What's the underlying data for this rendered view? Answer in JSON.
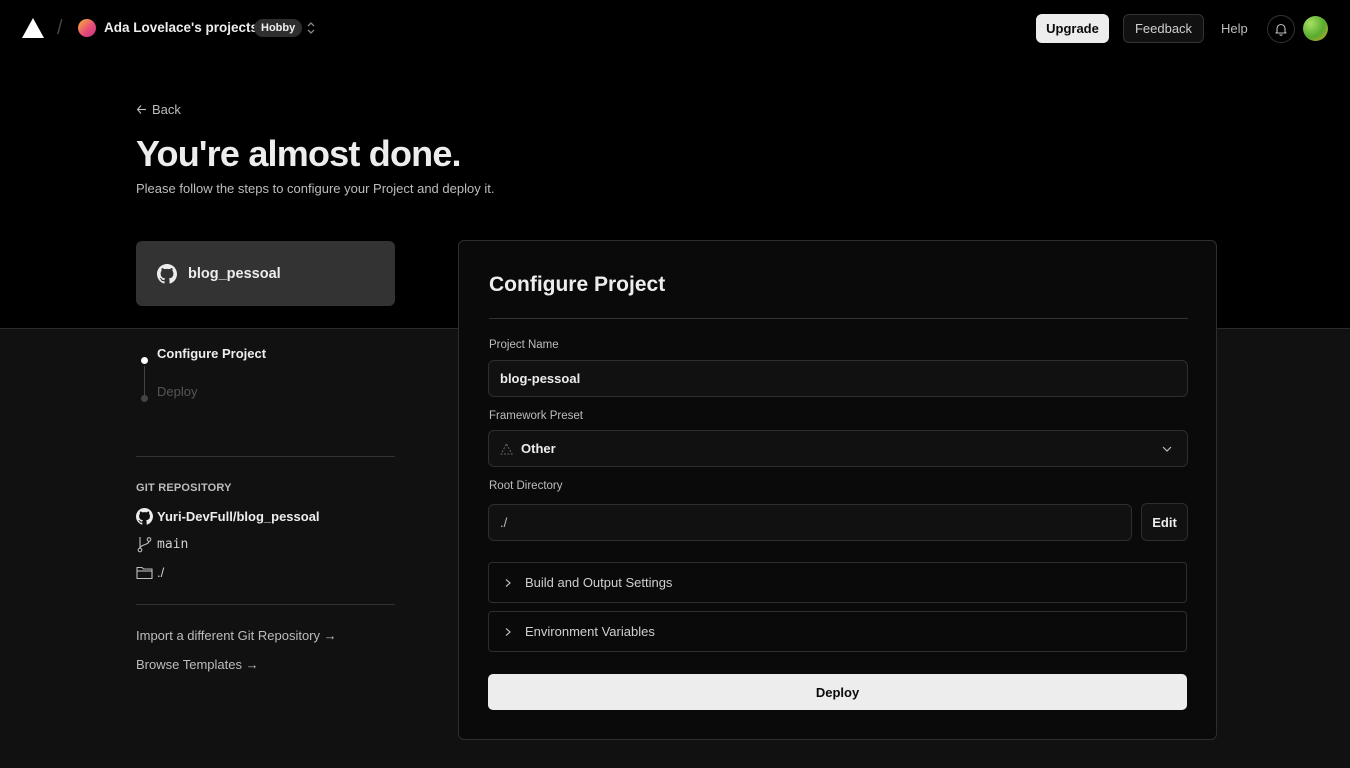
{
  "header": {
    "team_name": "Ada Lovelace's projects",
    "plan_badge": "Hobby",
    "upgrade_label": "Upgrade",
    "feedback_label": "Feedback",
    "help_label": "Help",
    "icons": [
      "vercel-logo-icon",
      "team-switcher-icon",
      "bell-icon"
    ]
  },
  "hero": {
    "back_label": "Back",
    "title": "You're almost done.",
    "subtitle": "Please follow the steps to configure your Project and deploy it."
  },
  "repo_card": {
    "repo_name": "blog_pessoal",
    "icon": "github-icon"
  },
  "steps": [
    {
      "label": "Configure Project",
      "state": "active"
    },
    {
      "label": "Deploy",
      "state": "pending"
    }
  ],
  "git": {
    "section_label": "GIT REPOSITORY",
    "repo": "Yuri-DevFull/blog_pessoal",
    "branch": "main",
    "directory": "./"
  },
  "links": {
    "import_label": "Import a different Git Repository →",
    "templates_label": "Browse Templates →"
  },
  "configure": {
    "title": "Configure Project",
    "project_name_label": "Project Name",
    "project_name_value": "blog-pessoal",
    "framework_label": "Framework Preset",
    "framework_value": "Other",
    "root_dir_label": "Root Directory",
    "root_dir_value": "./",
    "edit_label": "Edit",
    "build_settings_label": "Build and Output Settings",
    "env_vars_label": "Environment Variables",
    "deploy_label": "Deploy"
  },
  "colors": {
    "background": "#111111",
    "top_band": "#000000",
    "accent_light": "#ededed"
  }
}
